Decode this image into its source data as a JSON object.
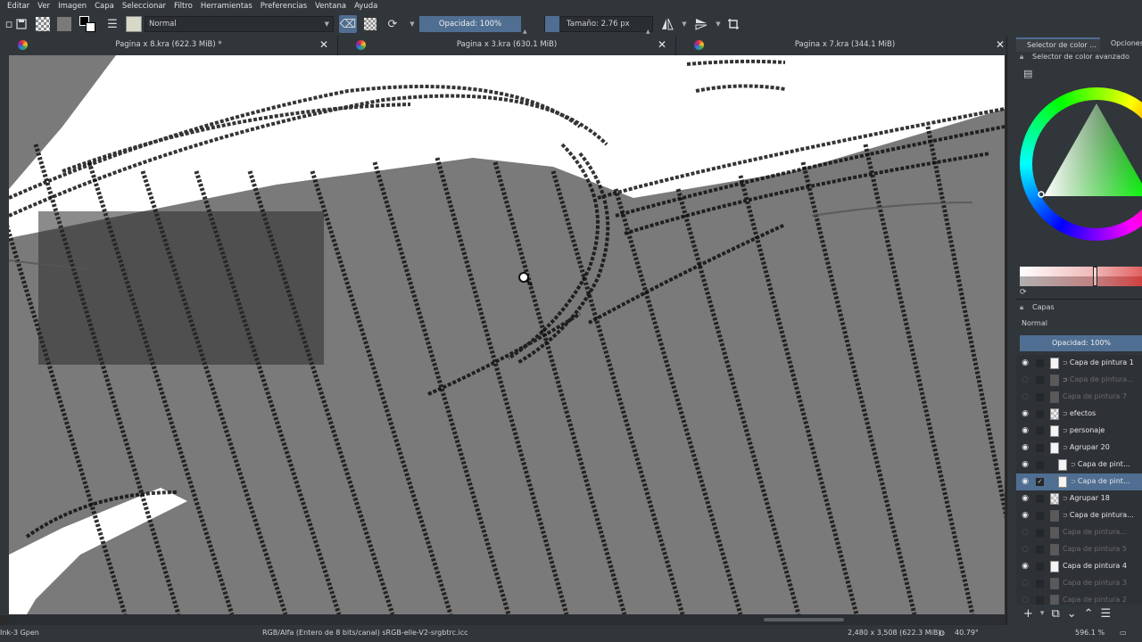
{
  "menu": [
    "Editar",
    "Ver",
    "Imagen",
    "Capa",
    "Seleccionar",
    "Filtro",
    "Herramientas",
    "Preferencias",
    "Ventana",
    "Ayuda"
  ],
  "toolbar": {
    "blend_mode": "Normal",
    "opacity": "Opacidad: 100%",
    "size": "Tamaño: 2.76 px"
  },
  "tabs": [
    {
      "label": "Pagina x 8.kra (622.3 MiB) *"
    },
    {
      "label": "Pagina x 3.kra (630.1 MiB)"
    },
    {
      "label": "Pagina x 7.kra (344.1 MiB)"
    }
  ],
  "docker": {
    "tabs": [
      "Selector de color ...",
      "Opciones d"
    ],
    "color_title": "Selector de color avanzado",
    "layers_title": "Capas",
    "layers_blend": "Normal",
    "layers_opacity": "Opacidad:  100%",
    "layers": [
      {
        "name": "Capa de pintura 1",
        "visible": true,
        "dim": false,
        "indent": 0,
        "group": true,
        "thumb": "white",
        "selected": false
      },
      {
        "name": "Capa de pintura...",
        "visible": false,
        "dim": true,
        "indent": 0,
        "group": true,
        "thumb": "dim",
        "selected": false
      },
      {
        "name": "Capa de pintura 7",
        "visible": false,
        "dim": true,
        "indent": 0,
        "group": false,
        "thumb": "dim",
        "selected": false
      },
      {
        "name": "efectos",
        "visible": true,
        "dim": false,
        "indent": 0,
        "group": true,
        "thumb": "check",
        "selected": false
      },
      {
        "name": "personaje",
        "visible": true,
        "dim": false,
        "indent": 0,
        "group": true,
        "thumb": "white",
        "selected": false
      },
      {
        "name": "Agrupar 20",
        "visible": true,
        "dim": false,
        "indent": 0,
        "group": true,
        "thumb": "white",
        "selected": false
      },
      {
        "name": "Capa de pint...",
        "visible": true,
        "dim": false,
        "indent": 1,
        "group": true,
        "thumb": "white",
        "selected": false
      },
      {
        "name": "Capa de pint...",
        "visible": true,
        "dim": false,
        "indent": 1,
        "group": true,
        "thumb": "white",
        "selected": true
      },
      {
        "name": "Agrupar 18",
        "visible": true,
        "dim": false,
        "indent": 0,
        "group": true,
        "thumb": "check",
        "selected": false
      },
      {
        "name": "Capa de pintura...",
        "visible": true,
        "dim": false,
        "indent": 0,
        "group": true,
        "thumb": "dim",
        "selected": false
      },
      {
        "name": "Capa de pintura...",
        "visible": false,
        "dim": true,
        "indent": 0,
        "group": false,
        "thumb": "dim",
        "selected": false
      },
      {
        "name": "Capa de pintura 5",
        "visible": false,
        "dim": true,
        "indent": 0,
        "group": false,
        "thumb": "dim",
        "selected": false
      },
      {
        "name": "Capa de pintura 4",
        "visible": true,
        "dim": false,
        "indent": 0,
        "group": false,
        "thumb": "white",
        "selected": false
      },
      {
        "name": "Capa de pintura 3",
        "visible": false,
        "dim": true,
        "indent": 0,
        "group": false,
        "thumb": "dim",
        "selected": false
      },
      {
        "name": "Capa de pintura 2",
        "visible": false,
        "dim": true,
        "indent": 0,
        "group": false,
        "thumb": "dim",
        "selected": false
      }
    ]
  },
  "status": {
    "brush": "Ink-3 Gpen",
    "color_profile": "RGB/Alfa (Entero de 8 bits/canal)  sRGB-elle-V2-srgbtrc.icc",
    "dimensions": "2,480 x 3,508 (622.3 MiB)",
    "rotation": "40.79°",
    "zoom": "596.1 %"
  },
  "colors": {
    "accent": "#4f6e92",
    "panel": "#31363b",
    "canvas_gray": "#7a7a7a"
  }
}
